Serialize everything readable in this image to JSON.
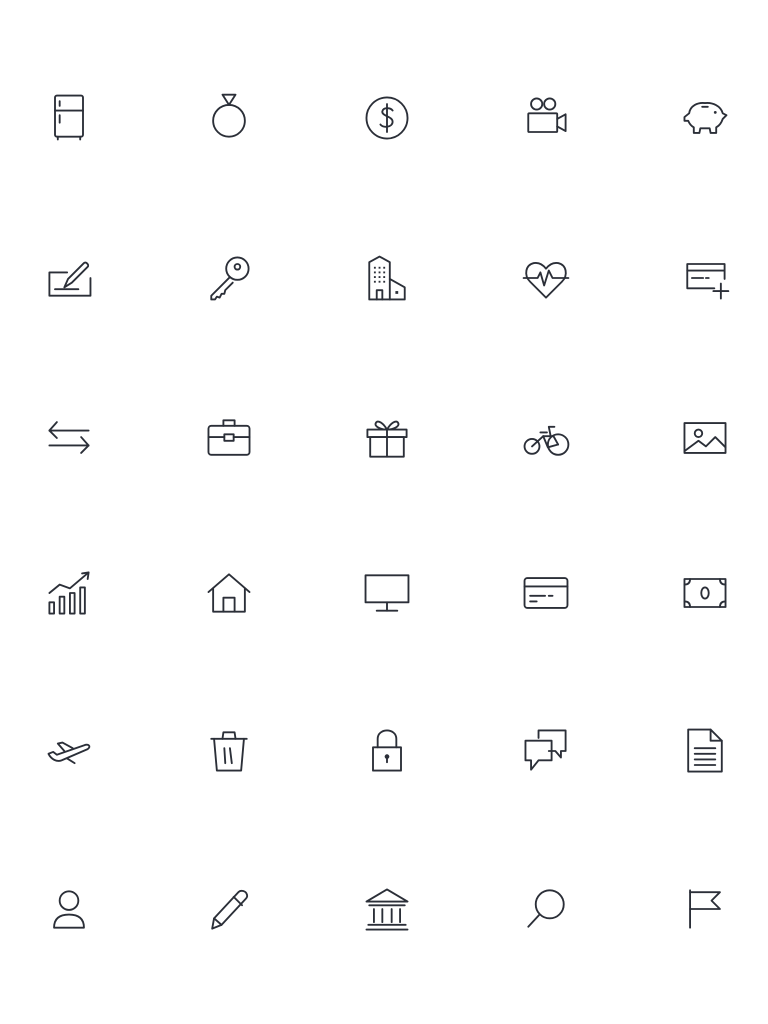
{
  "icon_color": "#2b2f38",
  "background_color": "#ffffff",
  "icons": [
    [
      "refrigerator-icon",
      "ring-icon",
      "dollar-coin-icon",
      "video-camera-icon",
      "piggy-bank-icon"
    ],
    [
      "signature-pen-icon",
      "key-icon",
      "office-building-icon",
      "heart-pulse-icon",
      "add-card-icon"
    ],
    [
      "transfer-arrows-icon",
      "briefcase-icon",
      "gift-icon",
      "bicycle-icon",
      "image-icon"
    ],
    [
      "growth-chart-icon",
      "home-icon",
      "monitor-icon",
      "credit-card-icon",
      "banknote-icon"
    ],
    [
      "airplane-takeoff-icon",
      "trash-can-icon",
      "padlock-icon",
      "chat-bubbles-icon",
      "document-icon"
    ],
    [
      "user-icon",
      "pencil-icon",
      "bank-icon",
      "search-icon",
      "flag-icon"
    ]
  ]
}
